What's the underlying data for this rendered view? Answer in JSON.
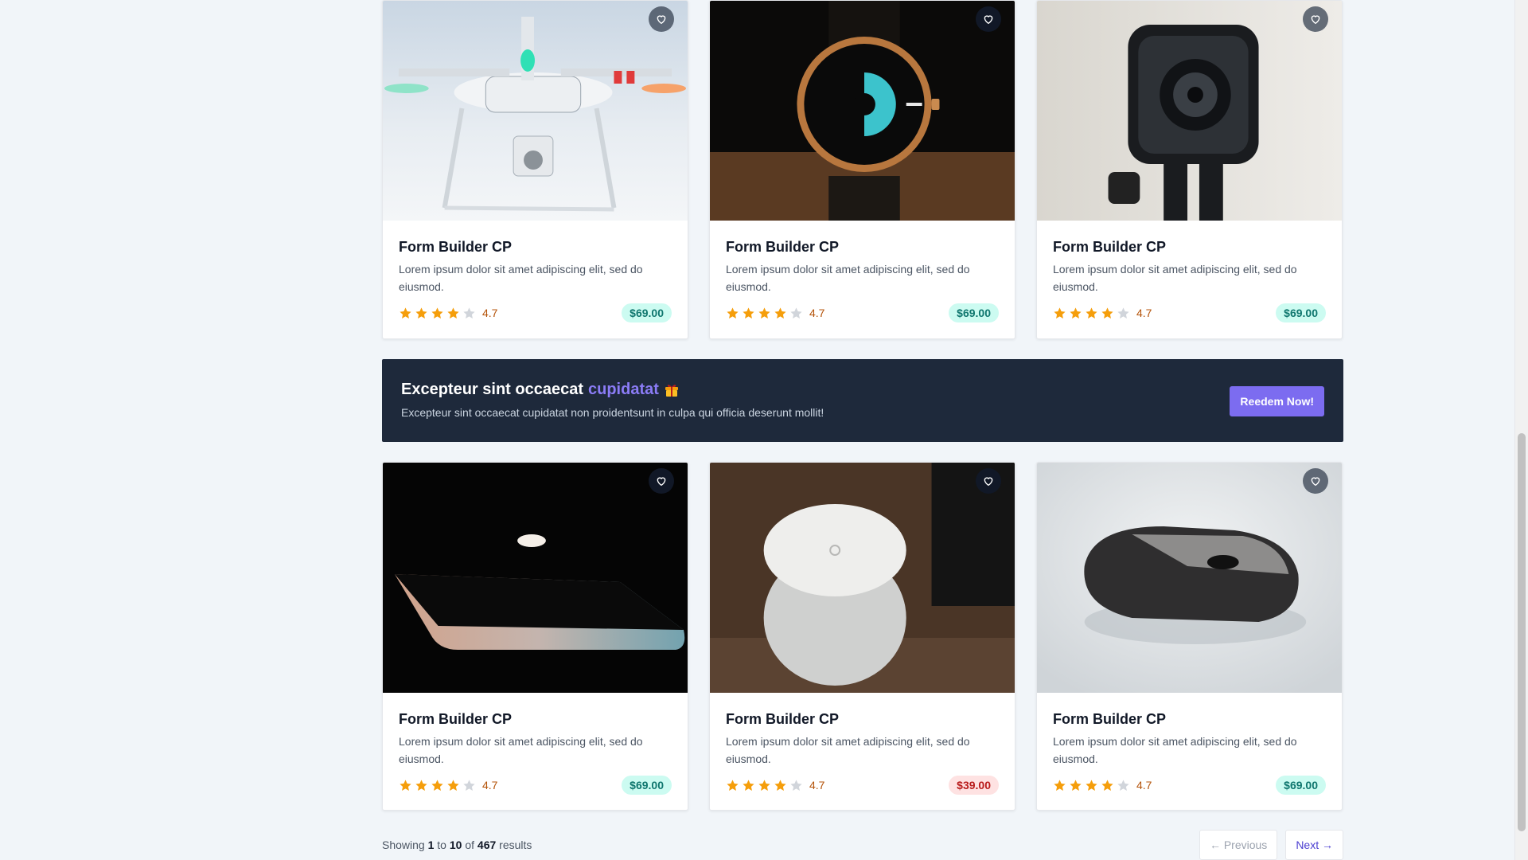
{
  "products_row1": [
    {
      "title": "Form Builder CP",
      "description": "Lorem ipsum dolor sit amet adipiscing elit, sed do eiusmod.",
      "rating": "4.7",
      "stars": 4,
      "price": "$69.00",
      "sale": false,
      "image": "drone"
    },
    {
      "title": "Form Builder CP",
      "description": "Lorem ipsum dolor sit amet adipiscing elit, sed do eiusmod.",
      "rating": "4.7",
      "stars": 4,
      "price": "$69.00",
      "sale": false,
      "image": "watch"
    },
    {
      "title": "Form Builder CP",
      "description": "Lorem ipsum dolor sit amet adipiscing elit, sed do eiusmod.",
      "rating": "4.7",
      "stars": 4,
      "price": "$69.00",
      "sale": false,
      "image": "action-camera"
    }
  ],
  "banner": {
    "title_start": "Excepteur sint occaecat",
    "title_highlight": "cupidatat",
    "subtitle": "Excepteur sint occaecat cupidatat non proidentsunt in culpa qui officia deserunt mollit!",
    "button_label": "Reedem Now!",
    "icon": "gift-icon"
  },
  "products_row2": [
    {
      "title": "Form Builder CP",
      "description": "Lorem ipsum dolor sit amet adipiscing elit, sed do eiusmod.",
      "rating": "4.7",
      "stars": 4,
      "price": "$69.00",
      "sale": false,
      "image": "laptop"
    },
    {
      "title": "Form Builder CP",
      "description": "Lorem ipsum dolor sit amet adipiscing elit, sed do eiusmod.",
      "rating": "4.7",
      "stars": 4,
      "price": "$39.00",
      "sale": true,
      "image": "wifi-router"
    },
    {
      "title": "Form Builder CP",
      "description": "Lorem ipsum dolor sit amet adipiscing elit, sed do eiusmod.",
      "rating": "4.7",
      "stars": 4,
      "price": "$69.00",
      "sale": false,
      "image": "mouse"
    }
  ],
  "pagination": {
    "showing_label": "Showing",
    "from": "1",
    "to_label": "to",
    "to": "10",
    "of_label": "of",
    "total": "467",
    "results_label": "results",
    "previous_label": "← Previous",
    "next_label": "Next →"
  },
  "colors": {
    "page_bg": "#f1f5f9",
    "banner_bg": "#1e293b",
    "accent": "#7c6cf0",
    "star": "#f59e0b",
    "star_empty": "#d1d5db",
    "price_bg": "#ccfbf1",
    "price_text": "#0f766e",
    "sale_bg": "#fee2e2",
    "sale_text": "#b91c1c"
  }
}
